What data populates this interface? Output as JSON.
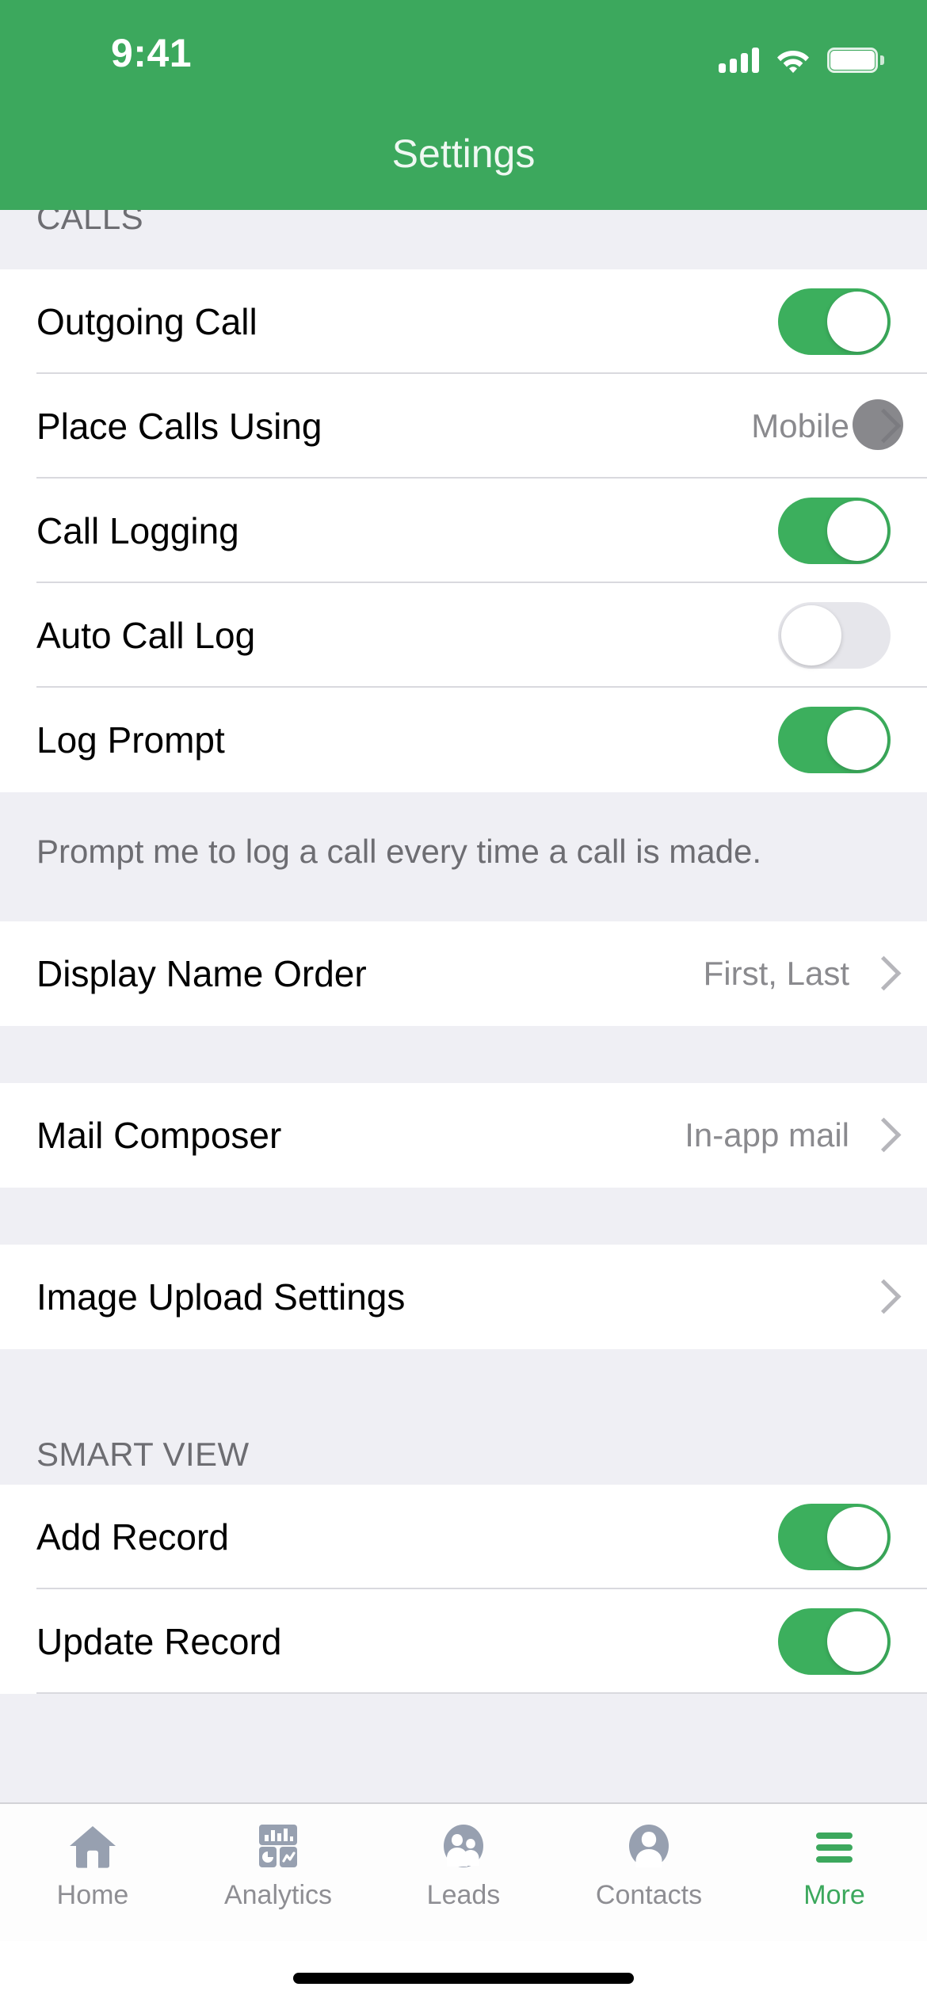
{
  "status_bar": {
    "time": "9:41",
    "signal_icon": "cellular-signal-icon",
    "wifi_icon": "wifi-icon",
    "battery_icon": "battery-full-icon"
  },
  "header": {
    "title": "Settings"
  },
  "sections": [
    {
      "id": "calls",
      "header": "CALLS",
      "rows": [
        {
          "label": "Outgoing Call",
          "control": "toggle",
          "state": "on"
        },
        {
          "label": "Place Calls Using",
          "control": "value-chevron",
          "value": "Mobile"
        },
        {
          "label": "Call Logging",
          "control": "toggle",
          "state": "on"
        },
        {
          "label": "Auto Call Log",
          "control": "toggle",
          "state": "off"
        },
        {
          "label": "Log Prompt",
          "control": "toggle",
          "state": "on"
        }
      ],
      "footnote": "Prompt me to log a call every time a call is made."
    },
    {
      "id": "display-name",
      "header": "",
      "rows": [
        {
          "label": "Display Name Order",
          "control": "value-chevron",
          "value": "First, Last"
        }
      ]
    },
    {
      "id": "mail",
      "header": "",
      "rows": [
        {
          "label": "Mail Composer",
          "control": "value-chevron",
          "value": "In-app mail"
        }
      ]
    },
    {
      "id": "image-upload",
      "header": "",
      "rows": [
        {
          "label": "Image Upload Settings",
          "control": "chevron",
          "value": ""
        }
      ]
    },
    {
      "id": "smart-view",
      "header": "SMART VIEW",
      "rows": [
        {
          "label": "Add Record",
          "control": "toggle",
          "state": "on"
        },
        {
          "label": "Update Record",
          "control": "toggle",
          "state": "on"
        }
      ]
    }
  ],
  "tab_bar": {
    "items": [
      {
        "label": "Home",
        "icon": "home-icon",
        "active": false
      },
      {
        "label": "Analytics",
        "icon": "analytics-icon",
        "active": false
      },
      {
        "label": "Leads",
        "icon": "leads-icon",
        "active": false
      },
      {
        "label": "Contacts",
        "icon": "contacts-icon",
        "active": false
      },
      {
        "label": "More",
        "icon": "hamburger-menu-icon",
        "active": true
      }
    ]
  },
  "colors": {
    "brand_green": "#3CA85D",
    "toggle_on": "#3CAF5D",
    "toggle_off": "#E6E6EB",
    "group_background": "#EFEFF4",
    "row_background": "#FFFFFF",
    "secondary_text": "#8A8A8E",
    "section_header_text": "#6D6D72",
    "tab_inactive": "#8E8E93"
  },
  "cursor": {
    "visible": true,
    "over": "place-calls-using-chevron"
  }
}
